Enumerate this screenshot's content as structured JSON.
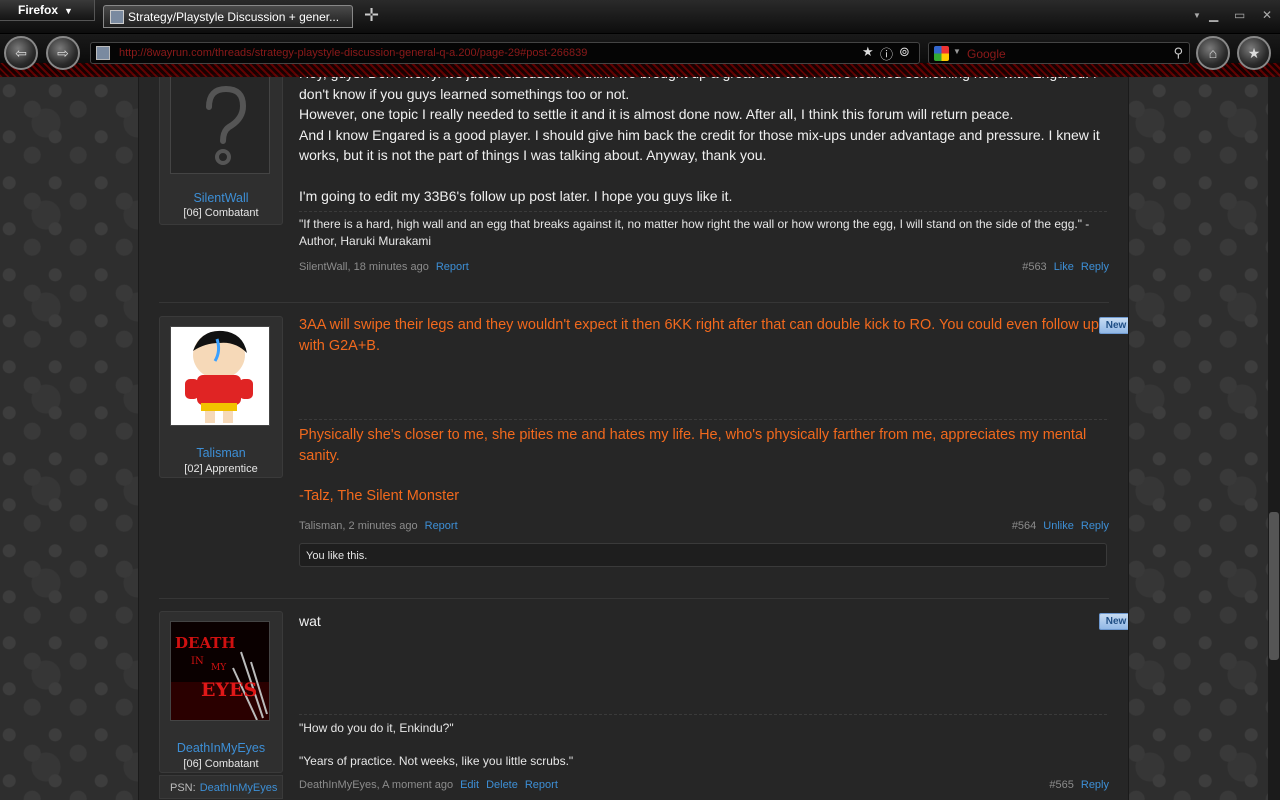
{
  "browser": {
    "menu_label": "Firefox",
    "tab_title": "Strategy/Playstyle Discussion + gener...",
    "url": "http://8wayrun.com/threads/strategy-playstyle-discussion-general-q-a.200/page-29#post-266839",
    "search_engine": "Google",
    "search_placeholder": "Google"
  },
  "posts": [
    {
      "user": "SilentWall",
      "title": "[06] Combatant",
      "avatar": "question-mark",
      "body": [
        "Hey, guys! Don't worry. It's just a discussion. I think we brought up a great one too. I have learned something new with Engared. I don't know if you guys learned somethings too or not.",
        "However, one topic I really needed to settle it and it is almost done now. After all, I think this forum will return peace.",
        "And I know Engared is a good player. I should give him back the credit for those mix-ups under advantage and pressure. I knew it works, but it is not the part of things I was talking about. Anyway, thank you.",
        "",
        "I'm going to edit my 33B6's follow up post later. I hope you guys like it."
      ],
      "signature": "\"If there is a hard, high wall and an egg that breaks against it, no matter how right the wall or how wrong the egg, I will stand on the side of the egg.\" - Author, Haruki Murakami",
      "meta": "SilentWall, 18 minutes ago",
      "report": "Report",
      "number": "#563",
      "like": "Like",
      "reply": "Reply"
    },
    {
      "user": "Talisman",
      "title": "[02] Apprentice",
      "avatar": "cartoon-child",
      "badge": "New",
      "body": "3AA will swipe their legs and they wouldn't expect it then 6KK right after that can double kick to RO. You could even follow up with G2A+B.",
      "signature": [
        "Physically she's closer to me, she pities me and hates my life. He, who's physically farther from me, appreciates my mental sanity.",
        "-Talz, The Silent Monster"
      ],
      "meta": "Talisman, 2 minutes ago",
      "report": "Report",
      "number": "#564",
      "like": "Unlike",
      "reply": "Reply",
      "likes": "You like this."
    },
    {
      "user": "DeathInMyEyes",
      "title": "[06] Combatant",
      "avatar": "death-in-my-eyes",
      "avatar_text": [
        "DEATH",
        "IN",
        "MY",
        "EYES"
      ],
      "badge": "New",
      "body": "wat",
      "signature": [
        "\"How do you do it, Enkindu?\"",
        "\"Years of practice. Not weeks, like you little scrubs.\""
      ],
      "meta": "DeathInMyEyes, A moment ago",
      "edit": "Edit",
      "delete": "Delete",
      "report": "Report",
      "number": "#565",
      "reply": "Reply",
      "psn_label": "PSN:",
      "psn_value": "DeathInMyEyes"
    }
  ],
  "colors": {
    "accent_link": "#3d8fd6",
    "orange_text": "#f2691d",
    "url_text": "#8b1a1a"
  }
}
